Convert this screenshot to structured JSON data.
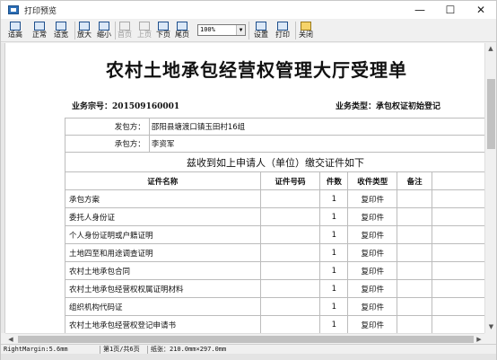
{
  "window": {
    "title": "打印预览",
    "controls": {
      "minimize": "—",
      "maximize": "☐",
      "close": "✕"
    }
  },
  "toolbar": {
    "buttons": [
      {
        "label": "适高",
        "icon": "fit-height-icon",
        "enabled": true
      },
      {
        "label": "正常",
        "icon": "normal-size-icon",
        "enabled": true
      },
      {
        "label": "适宽",
        "icon": "fit-width-icon",
        "enabled": true
      },
      {
        "label": "放大",
        "icon": "zoom-in-icon",
        "enabled": true
      },
      {
        "label": "缩小",
        "icon": "zoom-out-icon",
        "enabled": true
      },
      {
        "label": "首页",
        "icon": "first-page-icon",
        "enabled": false
      },
      {
        "label": "上页",
        "icon": "prev-page-icon",
        "enabled": false
      },
      {
        "label": "下页",
        "icon": "next-page-icon",
        "enabled": true
      },
      {
        "label": "尾页",
        "icon": "last-page-icon",
        "enabled": true
      },
      {
        "label": "设置",
        "icon": "settings-icon",
        "enabled": true
      },
      {
        "label": "打印",
        "icon": "print-icon",
        "enabled": true
      },
      {
        "label": "关闭",
        "icon": "close-folder-icon",
        "enabled": true
      }
    ],
    "zoom_value": "100%"
  },
  "document": {
    "title": "农村土地承包经营权管理大厅受理单",
    "case_no_label": "业务宗号：201509160001",
    "case_type_label": "业务类型：承包权证初始登记",
    "issuer_label": "发包方：",
    "issuer_value": "邵阳县塘渡口镇玉田村16组",
    "contractor_label": "承包方：",
    "contractor_value": "李资军",
    "acknowledgement": "兹收到如上申请人（单位）缴交证件如下",
    "table_headers": [
      "证件名称",
      "证件号码",
      "件数",
      "收件类型",
      "备注"
    ],
    "table_rows": [
      {
        "name": "承包方案",
        "number": "",
        "count": "1",
        "type": "复印件",
        "note": ""
      },
      {
        "name": "委托人身份证",
        "number": "",
        "count": "1",
        "type": "复印件",
        "note": ""
      },
      {
        "name": "个人身份证明或户籍证明",
        "number": "",
        "count": "1",
        "type": "复印件",
        "note": ""
      },
      {
        "name": "土地四至和用途调查证明",
        "number": "",
        "count": "1",
        "type": "复印件",
        "note": ""
      },
      {
        "name": "农村土地承包合同",
        "number": "",
        "count": "1",
        "type": "复印件",
        "note": ""
      },
      {
        "name": "农村土地承包经营权权属证明材料",
        "number": "",
        "count": "1",
        "type": "复印件",
        "note": ""
      },
      {
        "name": "组织机构代码证",
        "number": "",
        "count": "1",
        "type": "复印件",
        "note": ""
      },
      {
        "name": "农村土地承包经营权登记申请书",
        "number": "",
        "count": "1",
        "type": "复印件",
        "note": ""
      }
    ]
  },
  "statusbar": {
    "margin": "RightMargin:5.6mm",
    "page": "第1页/共6页",
    "paper": "纸张：210.0mm×297.0mm"
  }
}
